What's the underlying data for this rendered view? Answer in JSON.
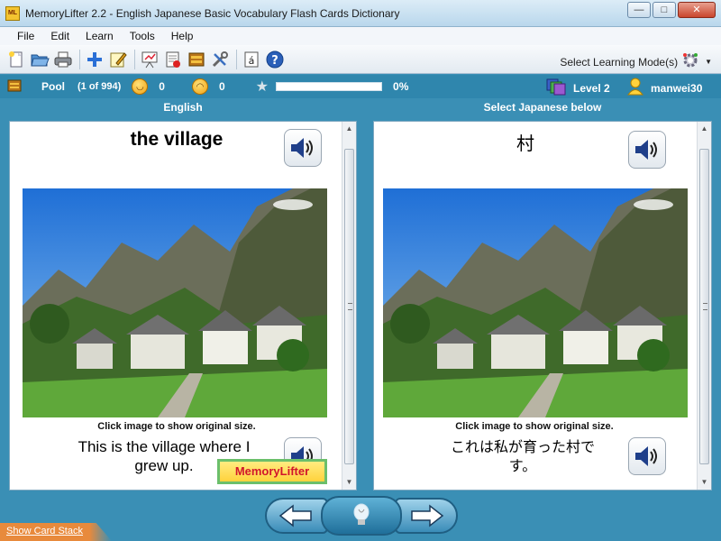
{
  "window": {
    "app_icon_text": "ML",
    "title": "MemoryLifter 2.2 - English Japanese Basic Vocabulary Flash Cards Dictionary",
    "minimize": "—",
    "maximize": "□",
    "close": "✕"
  },
  "menu": [
    "File",
    "Edit",
    "Learn",
    "Tools",
    "Help"
  ],
  "toolbar": {
    "icons": [
      "new-document-icon",
      "open-folder-icon",
      "print-icon",
      "add-card-icon",
      "edit-cards-icon",
      "presentation-icon",
      "statistics-icon",
      "card-box-icon",
      "settings-tools-icon",
      "special-character-icon",
      "help-icon"
    ],
    "learning_mode_label": "Select Learning Mode(s)"
  },
  "status": {
    "pool_label": "Pool",
    "pool_count": "(1 of 994)",
    "correct_count": "0",
    "wrong_count": "0",
    "progress_percent": 0,
    "progress_text": "0%",
    "level": "Level 2",
    "username": "manwei30"
  },
  "left_panel": {
    "header": "English",
    "word": "the village",
    "image_hint": "Click image to show original size.",
    "sentence": "This is the village where I grew up.",
    "watermark": "MemoryLifter"
  },
  "right_panel": {
    "header": "Select Japanese below",
    "word": "村",
    "image_hint": "Click image to show original size.",
    "sentence": "これは私が育った村です。"
  },
  "bottom": {
    "show_card_stack": "Show Card Stack"
  },
  "colors": {
    "accent": "#2f86ad",
    "background": "#3a8fb5",
    "stack_tab": "#e88a3c"
  }
}
